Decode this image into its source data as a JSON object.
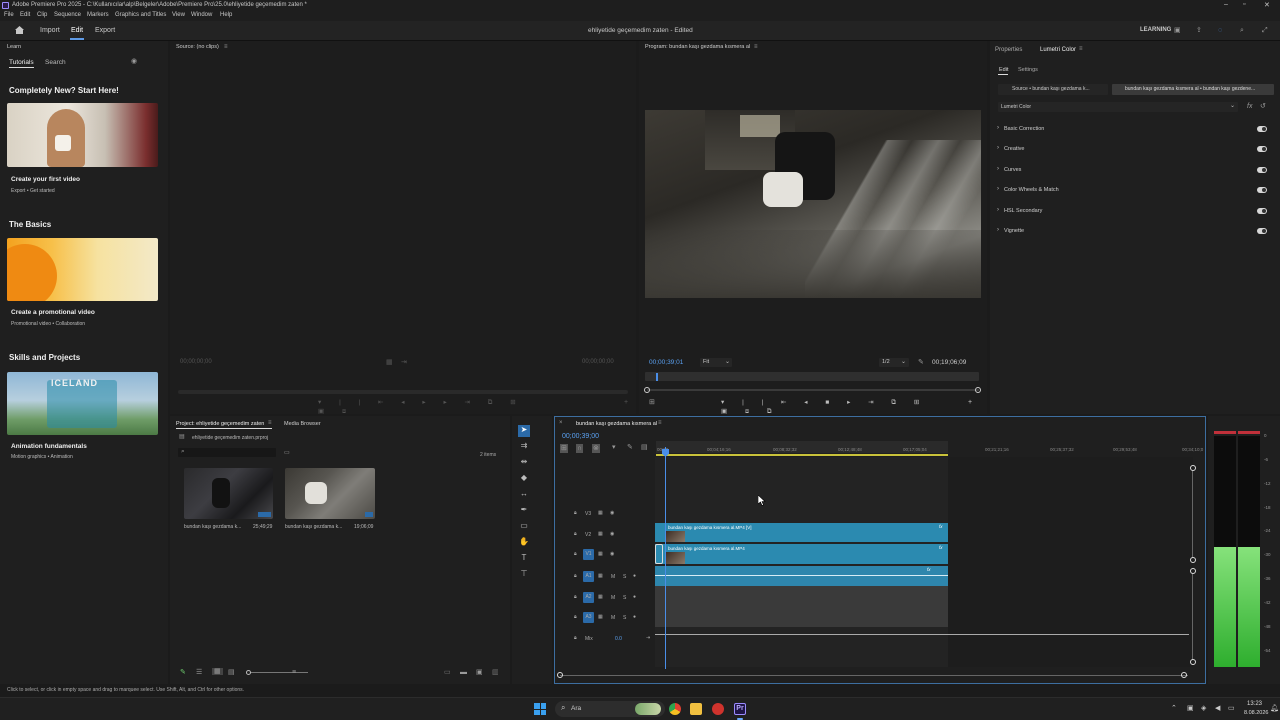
{
  "app": {
    "window_title": "Adobe Premiere Pro 2025 - C:\\Kullanıcılar\\alp\\Belgeler\\Adobe\\Premiere Pro\\25.0\\ehliyetide geçemedim zaten *",
    "menu": [
      "File",
      "Edit",
      "Clip",
      "Sequence",
      "Markers",
      "Graphics and Titles",
      "View",
      "Window",
      "Help"
    ],
    "header_tabs": [
      "Import",
      "Edit",
      "Export"
    ],
    "active_tab": "Edit",
    "project_title": "ehliyetide geçemedim zaten - Edited",
    "learning_label": "LEARNING"
  },
  "learn": {
    "title": "Learn",
    "tabs": [
      "Tutorials",
      "Search"
    ],
    "sections": [
      {
        "heading": "Completely New? Start Here!",
        "card_title": "Create your first video",
        "card_sub": "Export • Get started"
      },
      {
        "heading": "The Basics",
        "card_title": "Create a promotional video",
        "card_sub": "Promotional video • Collaboration"
      },
      {
        "heading": "Skills and Projects",
        "card_title": "Animation fundamentals",
        "card_sub": "Motion graphics • Animation"
      }
    ],
    "iceland_text": "ICELAND"
  },
  "source": {
    "title": "Source: (no clips)",
    "tc_left": "00;00;00;00",
    "tc_right": "00;00;00;00"
  },
  "program": {
    "title": "Program: bundan kaşı gezdama kısmera al",
    "timecode": "00;00;39;01",
    "fit": "Fit",
    "quality": "1/2",
    "duration": "00;19;06;09"
  },
  "lumetri": {
    "tabs": [
      "Properties",
      "Lumetri Color"
    ],
    "subtabs": [
      "Edit",
      "Settings"
    ],
    "source_label": "Source • bundan kaşı gezdama k...",
    "clip_label": "bundan kaşı gezdama kısmera al • bundan kaşı gezdene...",
    "effect": "Lumetri Color",
    "sections": [
      "Basic Correction",
      "Creative",
      "Curves",
      "Color Wheels & Match",
      "HSL Secondary",
      "Vignette"
    ]
  },
  "project": {
    "tabs": [
      "Project: ehliyetide geçemedim zaten",
      "Media Browser"
    ],
    "file": "ehliyetide geçemedim zaten.prproj",
    "items_count": "2 items",
    "clips": [
      {
        "name": "bundan kaşı gezdama k...",
        "duration": "25;49;29"
      },
      {
        "name": "bundan kaşı gezdama k...",
        "duration": "19;06;09"
      }
    ]
  },
  "timeline": {
    "title": "bundan kaşı gezdama kısmera al",
    "timecode": "00;00;39;00",
    "ruler": [
      "00;00",
      "00;04;16;16",
      "00;08;32;32",
      "00;12;48;48",
      "00;17;05;04",
      "00;21;21;16",
      "00;25;37;32",
      "00;29;53;48",
      "00;34;10;0"
    ],
    "video_tracks": [
      "V3",
      "V2",
      "V1"
    ],
    "audio_tracks": [
      "A1",
      "A2",
      "A3"
    ],
    "mix_label": "Mix",
    "mix_value": "0.0",
    "clip_v2": "bundan kaşı gezdama kısmera al.MP4 [V]",
    "clip_v1": "bundan kaşı gezdama kısmera al.MP4"
  },
  "meter": {
    "scale": [
      "0",
      "-6",
      "-12",
      "-18",
      "-24",
      "-30",
      "-36",
      "-42",
      "-48",
      "-54"
    ],
    "level_left": 0.52,
    "level_right": 0.52
  },
  "status": {
    "text": "Click to select, or click in empty space and drag to marquee select. Use Shift, Alt, and Ctrl for other options."
  },
  "taskbar": {
    "search": "Ara",
    "time": "13:23",
    "date": "8.08.2026"
  }
}
